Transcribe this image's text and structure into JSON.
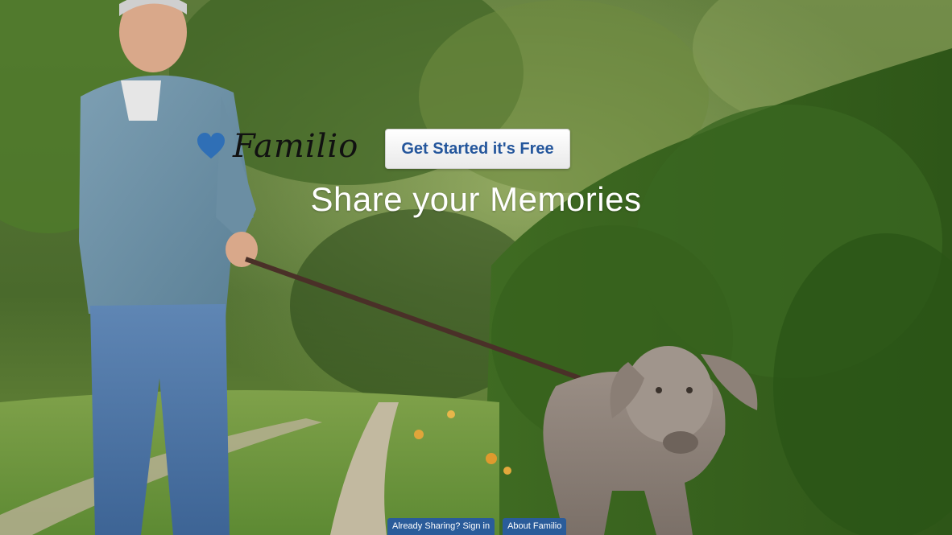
{
  "brand": {
    "name": "Familio",
    "heart_color": "#2f6fb6"
  },
  "hero": {
    "cta_label": "Get Started it's Free",
    "tagline": "Share your Memories"
  },
  "footer_links": [
    {
      "label": "Already Sharing? Sign in"
    },
    {
      "label": "About Familio"
    }
  ],
  "colors": {
    "link_background": "#2a5c9a",
    "cta_text": "#24569c"
  }
}
